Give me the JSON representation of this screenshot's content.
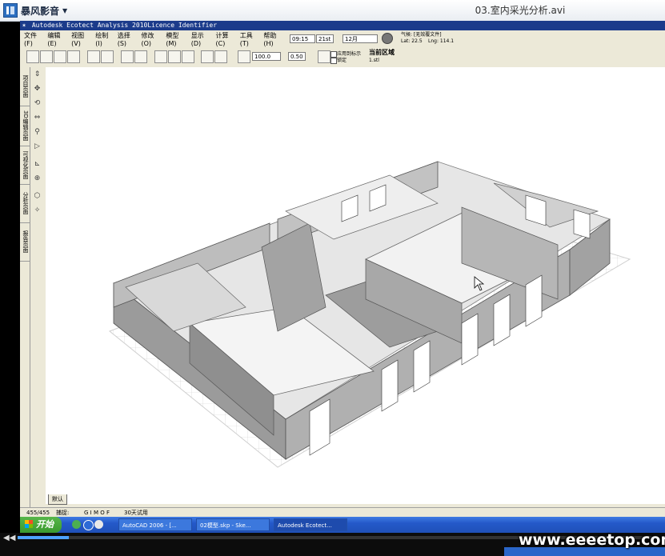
{
  "player": {
    "brand": "暴风影音",
    "title": "03.室内采光分析.avi",
    "progress": 0.08,
    "watermark": "www.eeeetop.com"
  },
  "app": {
    "title": "Autodesk Ecotect Analysis 2010Licence Identifier",
    "menu": [
      "文件(F)",
      "编辑(E)",
      "视图(V)",
      "绘制(I)",
      "选择(S)",
      "修改(O)",
      "模型(M)",
      "显示(D)",
      "计算(C)",
      "工具(T)",
      "帮助(H)"
    ],
    "time_value": "09:15",
    "day_value": "21st",
    "month_value": "12月",
    "weather_label": "气候: [无效覆文件]",
    "lat": "Lat: 22.5",
    "lng": "Lng: 114.1",
    "zoom_value": "100.0",
    "step_value": "0.50",
    "apply_label": "应用到标示",
    "lock_label": "锁定",
    "zone_title": "当前区域",
    "zone_value": "1.stl",
    "side_tabs": [
      "项目页面",
      "3D编辑页面",
      "可视化页面",
      "分析页面",
      "报告页面"
    ],
    "view_tab": "默认",
    "status": {
      "count": "455/455",
      "snap_label": "捕捉:",
      "snap_flags": "G I   M O F",
      "trial": "30天试用"
    }
  },
  "taskbar": {
    "start": "开始",
    "tasks": [
      "AutoCAD 2006 - [...",
      "02模型.skp - Ske...",
      "Autodesk Ecotect..."
    ]
  },
  "colors": {
    "titlebar": "#1b3b8b",
    "taskbar": "#2459c9",
    "wall": "#a6a6a6",
    "wall_dark": "#8a8a8a"
  }
}
